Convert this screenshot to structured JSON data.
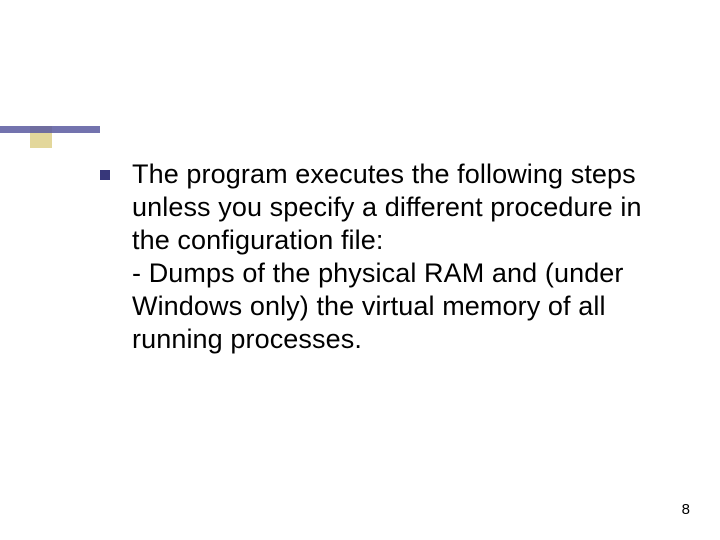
{
  "slide": {
    "bullet_text": "The program executes the following steps unless you specify a different procedure in the configuration file:",
    "sub_text": "- Dumps of the physical RAM and (under Windows only) the virtual memory of all running processes."
  },
  "page_number": "8"
}
